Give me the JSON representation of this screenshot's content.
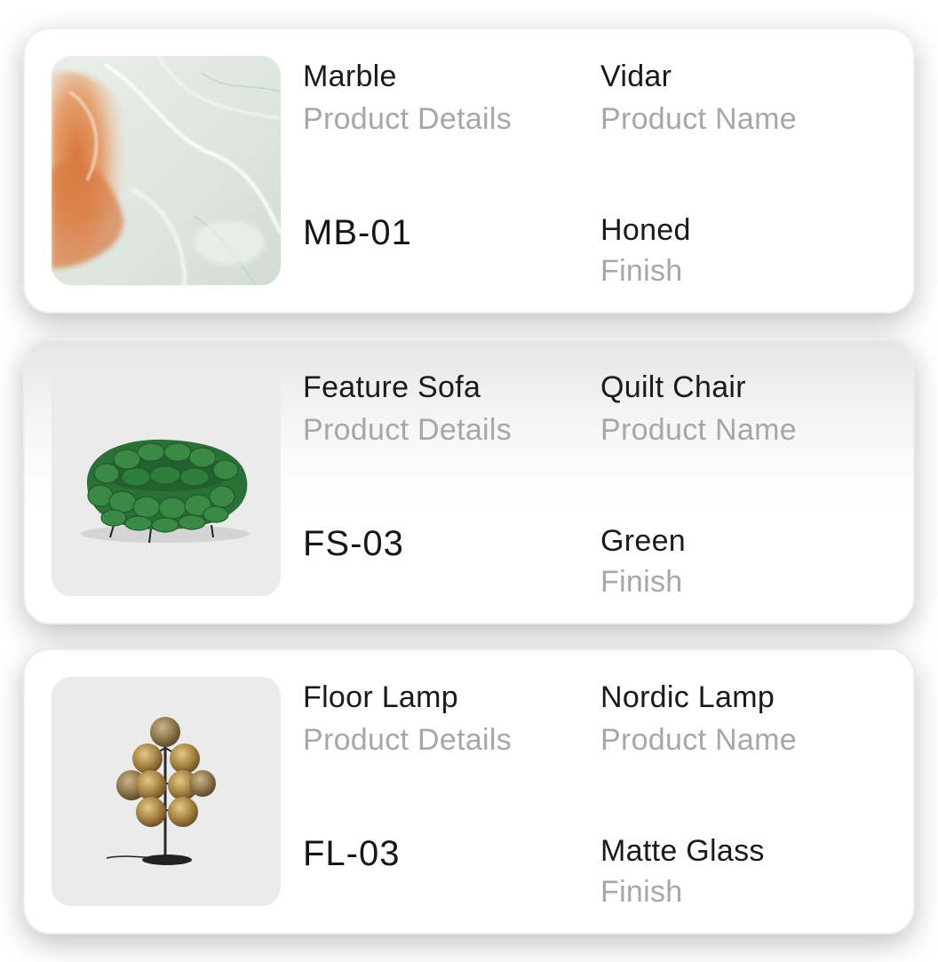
{
  "cards": [
    {
      "category": "Marble",
      "category_label": "Product Details",
      "code": "MB-01",
      "name": "Vidar",
      "name_label": "Product Name",
      "finish": "Honed",
      "finish_label": "Finish",
      "image": "marble-swatch"
    },
    {
      "category": "Feature Sofa",
      "category_label": "Product Details",
      "code": "FS-03",
      "name": "Quilt Chair",
      "name_label": "Product Name",
      "finish": "Green",
      "finish_label": "Finish",
      "image": "quilt-chair"
    },
    {
      "category": "Floor Lamp",
      "category_label": "Product Details",
      "code": "FL-03",
      "name": "Nordic Lamp",
      "name_label": "Product Name",
      "finish": "Matte Glass",
      "finish_label": "Finish",
      "image": "nordic-lamp"
    }
  ],
  "colors": {
    "primary_text": "#1a1a1a",
    "secondary_text": "#a7a7a7",
    "card_background": "#ffffff",
    "sofa_green": "#2f7a3c",
    "lamp_amber": "#a88545"
  }
}
